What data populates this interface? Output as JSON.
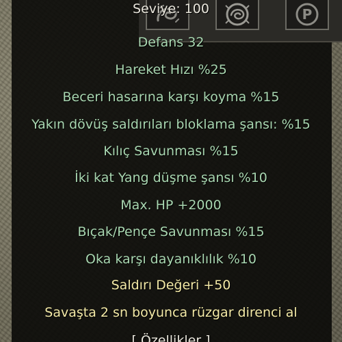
{
  "tooltip": {
    "level_line": "Seviye: 100",
    "defense_line": "Defans 32",
    "bonuses": [
      "Hareket Hızı %25",
      "Beceri hasarına karşı koyma %15",
      "Yakın dövüş saldırıları bloklama şansı: %15",
      "Kılıç Savunması %15",
      "İki kat Yang düşme şansı %10",
      "Max. HP  +2000",
      "Bıçak/Pençe Savunması %15",
      "Oka karşı dayanıklılık %10"
    ],
    "attack_value_line": "Saldırı Değeri  +50",
    "special_line": "Savaşta 2 sn boyunca rüzgar direnci al",
    "bottom_partial": "[ Özellikler ]"
  },
  "skillbar": {
    "slot_icons": [
      "swirl-icon",
      "dragon-emblem-icon",
      "letter-p-icon"
    ],
    "slot_3_letter": "P"
  },
  "colors": {
    "level_text": "#e9e6dc",
    "defense_text": "#a8d6b0",
    "bonus_text": "#a8d6b0",
    "attack_value_text": "#f3e9a6",
    "special_text": "#f3e9a6",
    "panel_background": "#0a0a08",
    "slot_border": "#6b6a63"
  }
}
